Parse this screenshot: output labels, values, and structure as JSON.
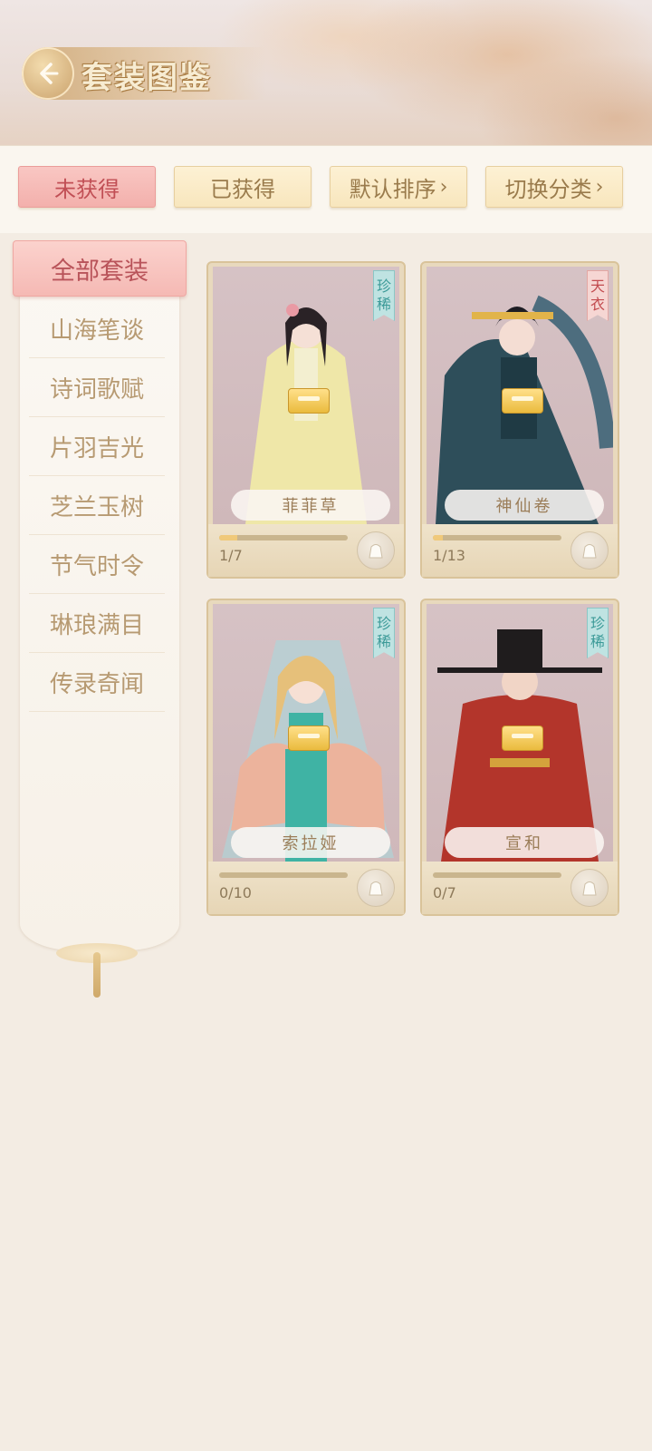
{
  "header": {
    "title": "套装图鉴"
  },
  "filters": {
    "unobtained": "未获得",
    "obtained": "已获得",
    "sort": "默认排序",
    "switch_category": "切换分类"
  },
  "categories": {
    "active": "全部套装",
    "items": [
      "山海笔谈",
      "诗词歌赋",
      "片羽吉光",
      "芝兰玉树",
      "节气时令",
      "琳琅满目",
      "传录奇闻"
    ]
  },
  "cards": [
    {
      "name": "菲菲草",
      "rarity": [
        "珍",
        "稀"
      ],
      "rarity_type": "rare",
      "progress": "1/7",
      "fraction": 0.143
    },
    {
      "name": "神仙卷",
      "rarity": [
        "天",
        "衣"
      ],
      "rarity_type": "heaven",
      "progress": "1/13",
      "fraction": 0.077
    },
    {
      "name": "索拉娅",
      "rarity": [
        "珍",
        "稀"
      ],
      "rarity_type": "rare",
      "progress": "0/10",
      "fraction": 0
    },
    {
      "name": "宣和",
      "rarity": [
        "珍",
        "稀"
      ],
      "rarity_type": "rare",
      "progress": "0/7",
      "fraction": 0
    }
  ],
  "colors": {
    "accent_pink": "#f5b9b4",
    "accent_gold": "#f8e6bd",
    "rare_teal": "#bfe3e2",
    "heaven_red": "#f6d6d3"
  }
}
